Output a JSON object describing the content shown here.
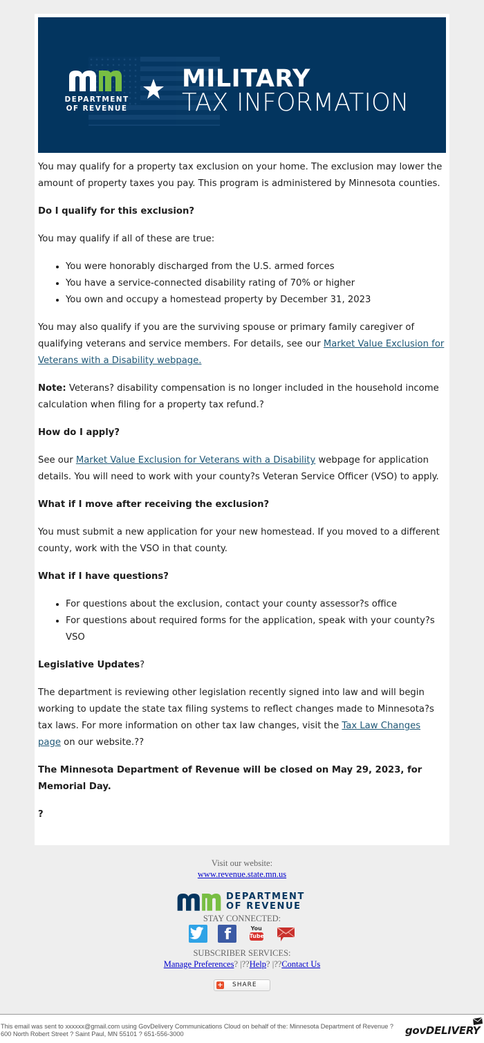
{
  "banner": {
    "logo_line1": "DEPARTMENT",
    "logo_line2": "OF REVENUE",
    "title_line1": "MILITARY",
    "title_line2": "TAX INFORMATION",
    "colors": {
      "background": "#03355f",
      "mn_green": "#78be43",
      "text": "#ffffff"
    }
  },
  "content": {
    "intro": "You may qualify for a property tax exclusion on your home. The exclusion may lower the amount of property taxes you pay. This program is administered by Minnesota counties.",
    "q1_heading": "Do I qualify for this exclusion?",
    "q1_lead": "You may qualify if all of these are true:",
    "q1_items": [
      "You were honorably discharged from the U.S. armed forces",
      "You have a service-connected disability rating of 70% or higher",
      "You own and occupy a homestead property by December 31, 2023"
    ],
    "also_qualify_text": "You may also qualify if you are the surviving spouse or primary family caregiver of qualifying veterans and service members. For details, see our ",
    "also_qualify_link": "Market Value Exclusion for Veterans with a Disability webpage.",
    "note_label": "Note:",
    "note_text": " Veterans? disability compensation is no longer included in the household income calculation when filing for a property tax refund.?",
    "q2_heading": "How do I apply?",
    "apply_prefix": "See our ",
    "apply_link": "Market Value Exclusion for Veterans with a Disability",
    "apply_suffix": " webpage for application details. You will need to work with your county?s Veteran Service Officer (VSO) to apply.",
    "q3_heading": "What if I move after receiving the exclusion?",
    "q3_text": "You must submit a new application for your new homestead. If you moved to a different county, work with the VSO in that county.",
    "q4_heading": "What if I have questions?",
    "q4_items": [
      "For questions about the exclusion, contact your county assessor?s office",
      "For questions about required forms for the application, speak with your county?s VSO"
    ],
    "leg_heading": "Legislative Updates",
    "leg_heading_suffix": "?",
    "leg_text_prefix": "The department is reviewing other legislation recently signed into law and will begin working to update the state tax filing systems to reflect changes made to Minnesota?s tax laws. For more information on other tax law changes, visit the ",
    "leg_link": "Tax Law Changes page",
    "leg_text_suffix": " on our website.??",
    "closure_notice": "The Minnesota Department of Revenue will be closed on May 29, 2023, for Memorial Day.",
    "trailing_mark": "?",
    "link_color": "#1f5877"
  },
  "footer": {
    "visit_label": "Visit our website:",
    "website_link": "www.revenue.state.mn.us",
    "logo_line1": "DEPARTMENT",
    "logo_line2": "OF REVENUE",
    "stay_connected": "STAY CONNECTED:",
    "social_icons": [
      "twitter-icon",
      "facebook-icon",
      "youtube-icon",
      "email-icon"
    ],
    "youtube_top": "You",
    "youtube_bottom": "Tube",
    "facebook_glyph": "f",
    "subscriber_services": "SUBSCRIBER SERVICES:",
    "manage_preferences": "Manage Preferences",
    "sep1": "? |??",
    "help": "Help",
    "sep2": "? |??",
    "contact_us": "Contact Us",
    "share_label": "SHARE",
    "share_plus": "+"
  },
  "bottom": {
    "disclaimer": "This email was sent to xxxxxx@gmail.com using GovDelivery Communications Cloud on behalf of the: Minnesota Department of Revenue ? 600 North Robert Street ? Saint Paul, MN 55101 ? 651-556-3000",
    "brand": "govDELIVERY"
  }
}
